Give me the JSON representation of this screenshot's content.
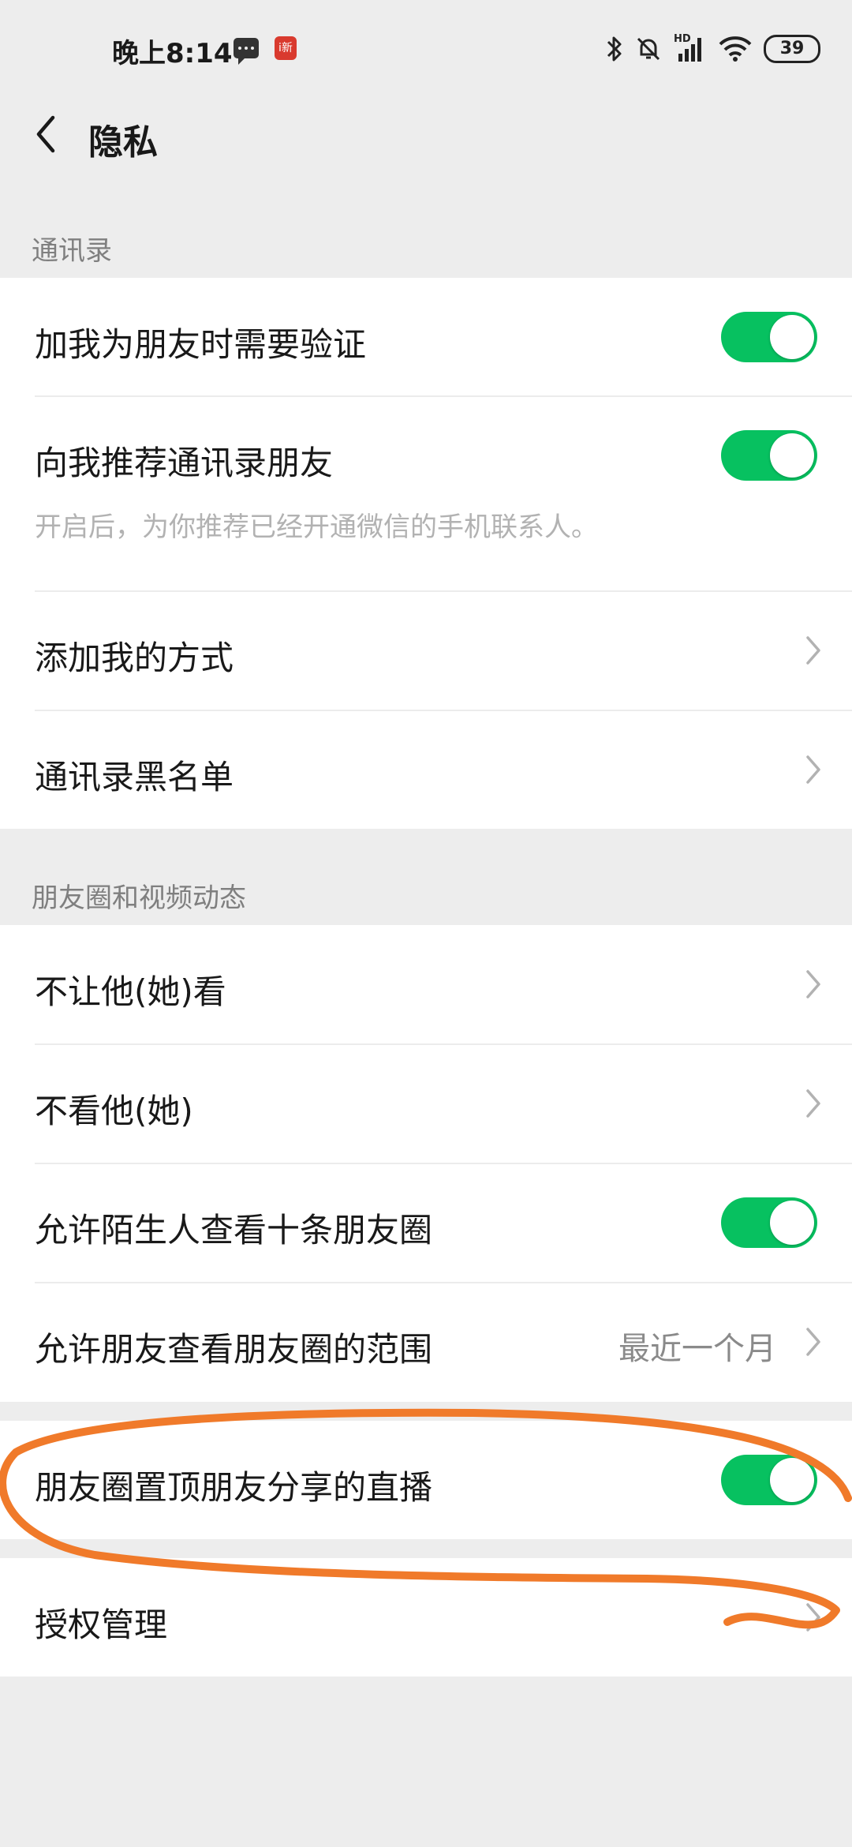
{
  "status_bar": {
    "time": "晚上8:14",
    "app_badge": "i新",
    "network_label": "HD",
    "battery": "39"
  },
  "nav": {
    "title": "隐私"
  },
  "contacts_section": {
    "header": "通讯录",
    "items": [
      {
        "label": "加我为朋友时需要验证",
        "control": "toggle",
        "on": true
      },
      {
        "label": "向我推荐通讯录朋友",
        "control": "toggle",
        "on": true,
        "description": "开启后，为你推荐已经开通微信的手机联系人。"
      },
      {
        "label": "添加我的方式",
        "control": "chevron"
      },
      {
        "label": "通讯录黑名单",
        "control": "chevron"
      }
    ]
  },
  "moments_section": {
    "header": "朋友圈和视频动态",
    "items": [
      {
        "label": "不让他(她)看",
        "control": "chevron"
      },
      {
        "label": "不看他(她)",
        "control": "chevron"
      },
      {
        "label": "允许陌生人查看十条朋友圈",
        "control": "toggle",
        "on": true
      },
      {
        "label": "允许朋友查看朋友圈的范围",
        "control": "chevron",
        "value": "最近一个月"
      }
    ]
  },
  "live_section": {
    "items": [
      {
        "label": "朋友圈置顶朋友分享的直播",
        "control": "toggle",
        "on": true
      }
    ]
  },
  "auth_section": {
    "items": [
      {
        "label": "授权管理",
        "control": "chevron"
      }
    ]
  },
  "colors": {
    "toggle_on": "#07c160",
    "annotation": "#f07a2a",
    "background": "#ededed"
  }
}
